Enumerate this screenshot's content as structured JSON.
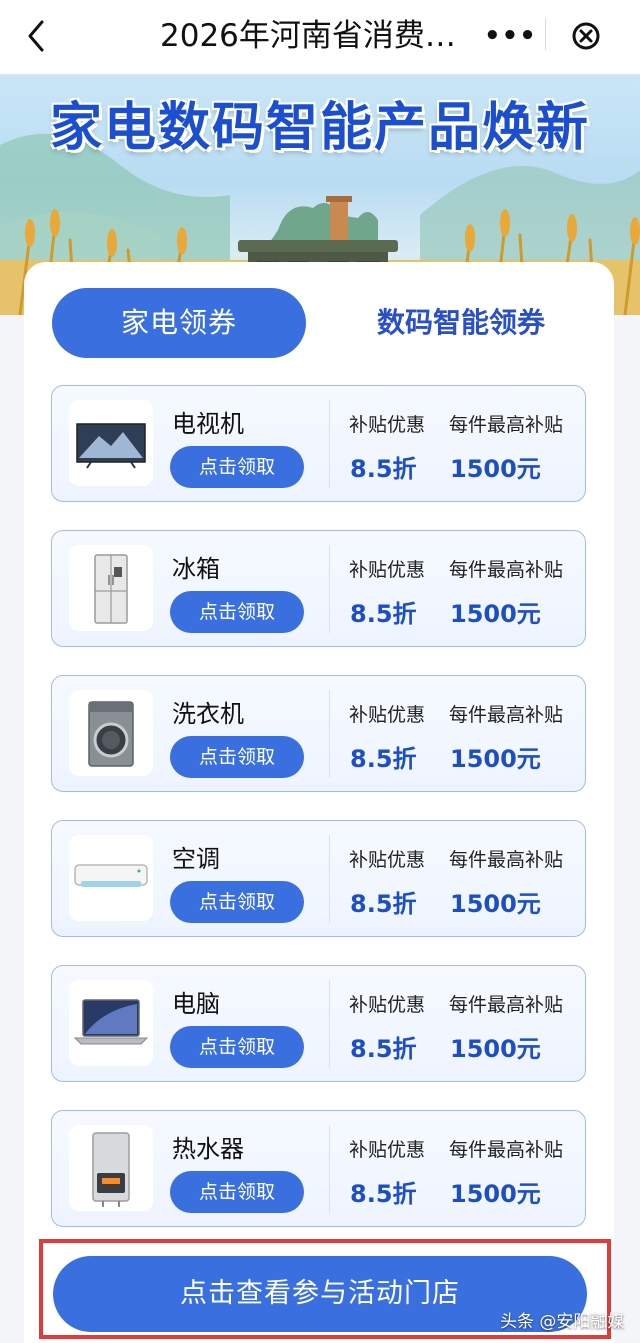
{
  "nav": {
    "title": "2026年河南省消费…",
    "more_label": "•••",
    "back_icon": "chevron-left-icon",
    "close_icon": "close-circle-icon"
  },
  "banner": {
    "title": "家电数码智能产品焕新",
    "colors": {
      "title": "#1c4fcf",
      "sky": "#c9e6f7",
      "wheat": "#e2b54a"
    }
  },
  "tabs": [
    {
      "label": "家电领券",
      "active": true
    },
    {
      "label": "数码智能领券",
      "active": false
    }
  ],
  "items": [
    {
      "name": "电视机",
      "icon": "tv-icon",
      "button": "点击领取",
      "discount_label": "补贴优惠",
      "discount": "8.5折",
      "max_label": "每件最高补贴",
      "max": "1500元"
    },
    {
      "name": "冰箱",
      "icon": "fridge-icon",
      "button": "点击领取",
      "discount_label": "补贴优惠",
      "discount": "8.5折",
      "max_label": "每件最高补贴",
      "max": "1500元"
    },
    {
      "name": "洗衣机",
      "icon": "washing-machine-icon",
      "button": "点击领取",
      "discount_label": "补贴优惠",
      "discount": "8.5折",
      "max_label": "每件最高补贴",
      "max": "1500元"
    },
    {
      "name": "空调",
      "icon": "air-conditioner-icon",
      "button": "点击领取",
      "discount_label": "补贴优惠",
      "discount": "8.5折",
      "max_label": "每件最高补贴",
      "max": "1500元"
    },
    {
      "name": "电脑",
      "icon": "laptop-icon",
      "button": "点击领取",
      "discount_label": "补贴优惠",
      "discount": "8.5折",
      "max_label": "每件最高补贴",
      "max": "1500元"
    },
    {
      "name": "热水器",
      "icon": "water-heater-icon",
      "button": "点击领取",
      "discount_label": "补贴优惠",
      "discount": "8.5折",
      "max_label": "每件最高补贴",
      "max": "1500元"
    }
  ],
  "cta": {
    "label": "点击查看参与活动门店"
  },
  "watermark": "头条 @安阳融媒",
  "colors": {
    "accent": "#3a6fe0",
    "value_text": "#1e4fc2",
    "highlight_frame": "#e63a3a"
  }
}
